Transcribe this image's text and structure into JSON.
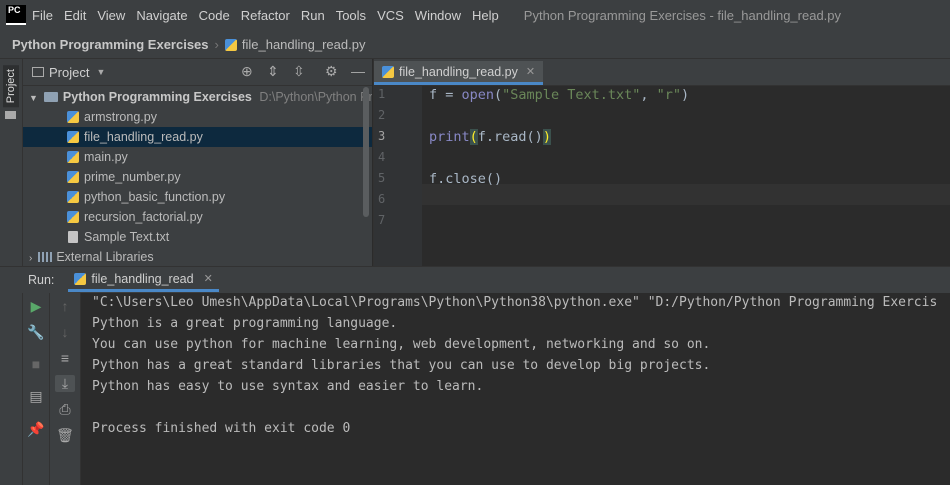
{
  "menubar": {
    "logo": "PC",
    "items": [
      "File",
      "Edit",
      "View",
      "Navigate",
      "Code",
      "Refactor",
      "Run",
      "Tools",
      "VCS",
      "Window",
      "Help"
    ],
    "window_title": "Python Programming Exercises - file_handling_read.py"
  },
  "navbar": {
    "project": "Python Programming Exercises",
    "file": "file_handling_read.py"
  },
  "sidebar": {
    "tool_label": "Project"
  },
  "project_panel": {
    "title": "Project",
    "root": {
      "name": "Python Programming Exercises",
      "path": "D:\\Python\\Python Progr"
    },
    "files": [
      "armstrong.py",
      "file_handling_read.py",
      "main.py",
      "prime_number.py",
      "python_basic_function.py",
      "recursion_factorial.py",
      "Sample Text.txt"
    ],
    "external": "External Libraries"
  },
  "editor": {
    "tab": "file_handling_read.py",
    "line_numbers": [
      "1",
      "2",
      "3",
      "4",
      "5",
      "6",
      "7"
    ],
    "code": {
      "l1_a": "f = ",
      "l1_open": "open",
      "l1_b": "(",
      "l1_s1": "\"Sample Text.txt\"",
      "l1_c": ", ",
      "l1_s2": "\"r\"",
      "l1_d": ")",
      "l3_print": "print",
      "l3_p1": "(",
      "l3_mid": "f.read()",
      "l3_p2": ")",
      "l5": "f.close()"
    }
  },
  "run": {
    "label": "Run:",
    "tab": "file_handling_read",
    "console": [
      "\"C:\\Users\\Leo Umesh\\AppData\\Local\\Programs\\Python\\Python38\\python.exe\" \"D:/Python/Python Programming Exercis",
      "Python is a great programming language.",
      "You can use python for machine learning, web development, networking and so on.",
      "Python has a great standard libraries that you can use to develop big projects.",
      "Python has easy to use syntax and easier to learn.",
      "",
      "Process finished with exit code 0"
    ]
  }
}
